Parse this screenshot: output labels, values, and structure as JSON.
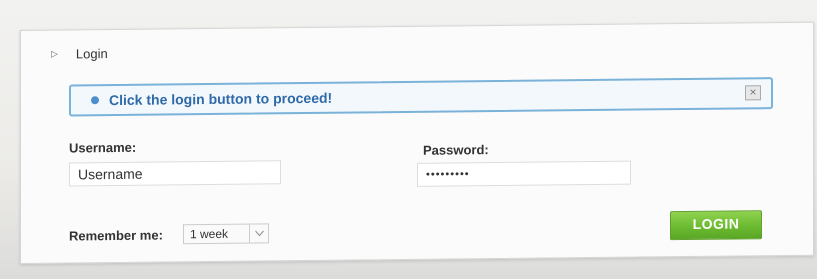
{
  "header": {
    "title": "Login",
    "toggle_icon": "collapse-arrow-icon"
  },
  "notice": {
    "message": "Click the login button to proceed!",
    "icon": "info-dot-icon",
    "close_icon": "close-icon",
    "accent_color": "#4c8fcd"
  },
  "form": {
    "username_label": "Username:",
    "username_value": "Username",
    "password_label": "Password:",
    "password_value": "•••••••••",
    "remember_label": "Remember me:",
    "remember_value": "1 week",
    "login_label": "LOGIN"
  },
  "colors": {
    "button": "#6cbb31",
    "notice_border": "#7ab2d9"
  }
}
